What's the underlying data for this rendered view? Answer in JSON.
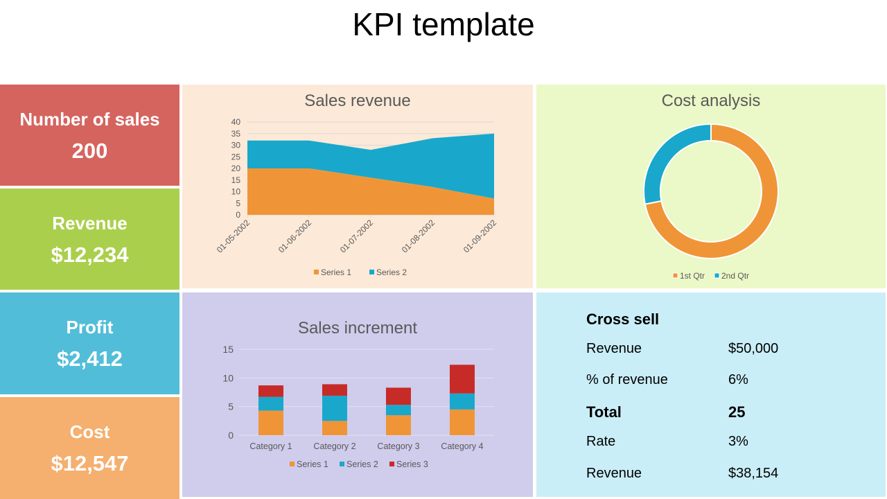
{
  "page": {
    "title": "KPI template"
  },
  "kpis": [
    {
      "label": "Number of sales",
      "value": "200",
      "color": "#D5645F"
    },
    {
      "label": "Revenue",
      "value": "$12,234",
      "color": "#AACF4C"
    },
    {
      "label": "Profit",
      "value": "$2,412",
      "color": "#52BDD8"
    },
    {
      "label": "Cost",
      "value": "$12,547",
      "color": "#F5AF6E"
    }
  ],
  "panels": {
    "sales_revenue_bg": "#FCE9D8",
    "cost_analysis_bg": "#EBF8C7",
    "sales_increment_bg": "#D0CCEC",
    "cross_sell_bg": "#CAEEF8"
  },
  "colors": {
    "series1": "#F09537",
    "series2": "#19A8CB",
    "series3": "#C72B27"
  },
  "cross_sell": {
    "title": "Cross sell",
    "rows": [
      {
        "label": "Revenue",
        "value": "$50,000",
        "bold": false
      },
      {
        "label": "% of revenue",
        "value": "6%",
        "bold": false
      },
      {
        "label": "Total",
        "value": "25",
        "bold": true
      },
      {
        "label": "Rate",
        "value": "3%",
        "bold": false
      },
      {
        "label": "Revenue",
        "value": "$38,154",
        "bold": false
      }
    ]
  },
  "chart_data": [
    {
      "type": "area",
      "stacked": true,
      "title": "Sales revenue",
      "categories": [
        "01-05-2002",
        "01-06-2002",
        "01-07-2002",
        "01-08-2002",
        "01-09-2002"
      ],
      "series": [
        {
          "name": "Series 1",
          "values": [
            20,
            20,
            16,
            12,
            7
          ]
        },
        {
          "name": "Series 2",
          "values": [
            12,
            12,
            12,
            21,
            28
          ]
        }
      ],
      "ylim": [
        0,
        40
      ],
      "yticks": [
        0,
        5,
        10,
        15,
        20,
        25,
        30,
        35,
        40
      ],
      "grid": true,
      "legend": "bottom"
    },
    {
      "type": "pie",
      "donut": true,
      "title": "Cost analysis",
      "labels": [
        "1st Qtr",
        "2nd Qtr"
      ],
      "values": [
        8.2,
        3.2
      ],
      "legend": "bottom"
    },
    {
      "type": "bar",
      "stacked": true,
      "title": "Sales increment",
      "categories": [
        "Category 1",
        "Category 2",
        "Category 3",
        "Category 4"
      ],
      "series": [
        {
          "name": "Series 1",
          "values": [
            4.3,
            2.5,
            3.5,
            4.5
          ]
        },
        {
          "name": "Series 2",
          "values": [
            2.4,
            4.4,
            1.8,
            2.8
          ]
        },
        {
          "name": "Series 3",
          "values": [
            2,
            2,
            3,
            5
          ]
        }
      ],
      "ylim": [
        0,
        15
      ],
      "yticks": [
        0,
        5,
        10,
        15
      ],
      "grid": true,
      "legend": "bottom"
    }
  ]
}
